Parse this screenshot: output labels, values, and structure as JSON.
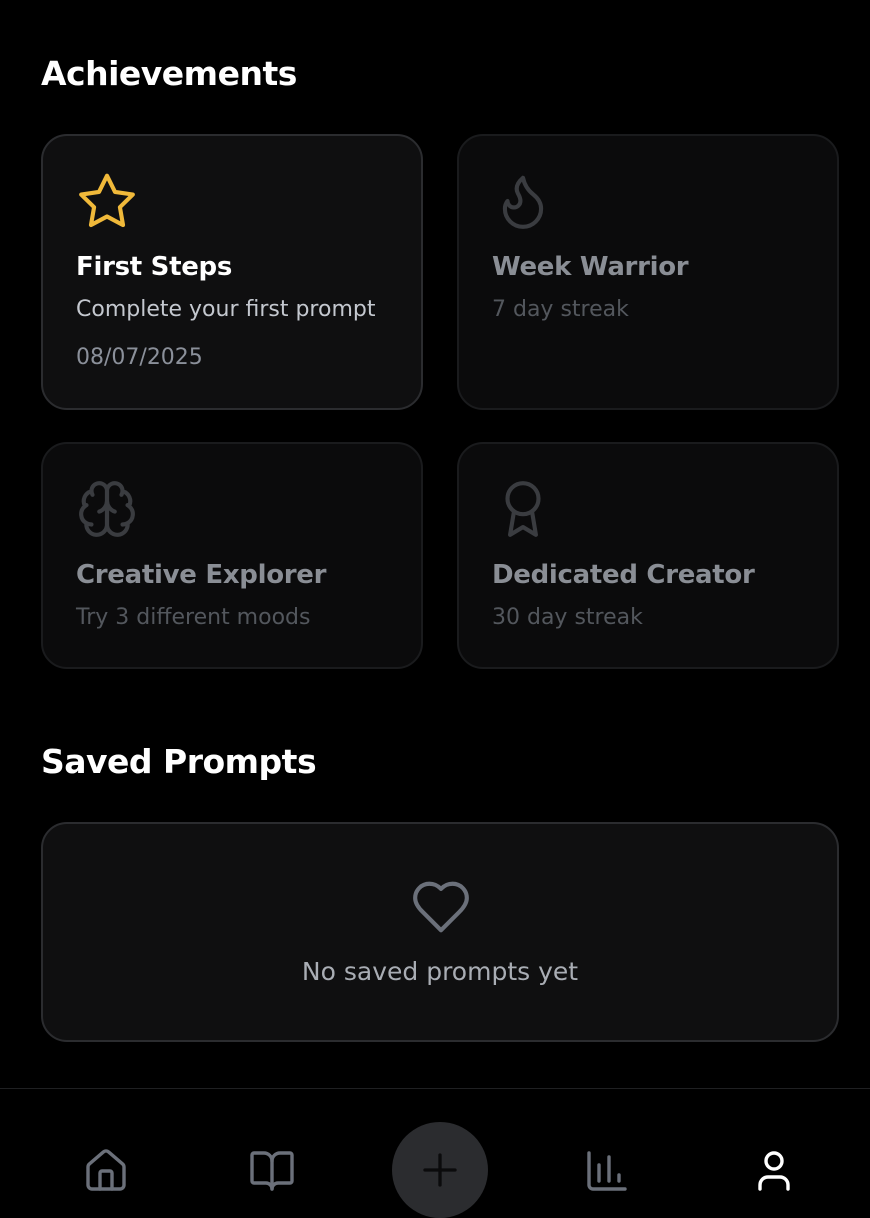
{
  "achievements": {
    "title": "Achievements",
    "items": [
      {
        "title": "First Steps",
        "description": "Complete your first prompt",
        "date": "08/07/2025",
        "icon": "star-icon",
        "unlocked": true,
        "icon_color": "#f0b93a"
      },
      {
        "title": "Week Warrior",
        "description": "7 day streak",
        "icon": "flame-icon",
        "unlocked": false
      },
      {
        "title": "Creative Explorer",
        "description": "Try 3 different moods",
        "icon": "brain-icon",
        "unlocked": false
      },
      {
        "title": "Dedicated Creator",
        "description": "30 day streak",
        "icon": "award-icon",
        "unlocked": false
      }
    ]
  },
  "saved_prompts": {
    "title": "Saved Prompts",
    "empty_text": "No saved prompts yet",
    "icon": "heart-icon"
  },
  "bottom_nav": {
    "items": [
      {
        "name": "home",
        "icon": "home-icon",
        "active": false
      },
      {
        "name": "library",
        "icon": "book-open-icon",
        "active": false
      },
      {
        "name": "create",
        "icon": "plus-icon",
        "active": false
      },
      {
        "name": "stats",
        "icon": "bar-chart-icon",
        "active": false
      },
      {
        "name": "profile",
        "icon": "user-icon",
        "active": true
      }
    ]
  },
  "colors": {
    "background": "#000000",
    "accent_gold": "#f0b93a",
    "locked_icon": "#3a3c40",
    "nav_icon": "#6b707a",
    "nav_active": "#ffffff"
  }
}
